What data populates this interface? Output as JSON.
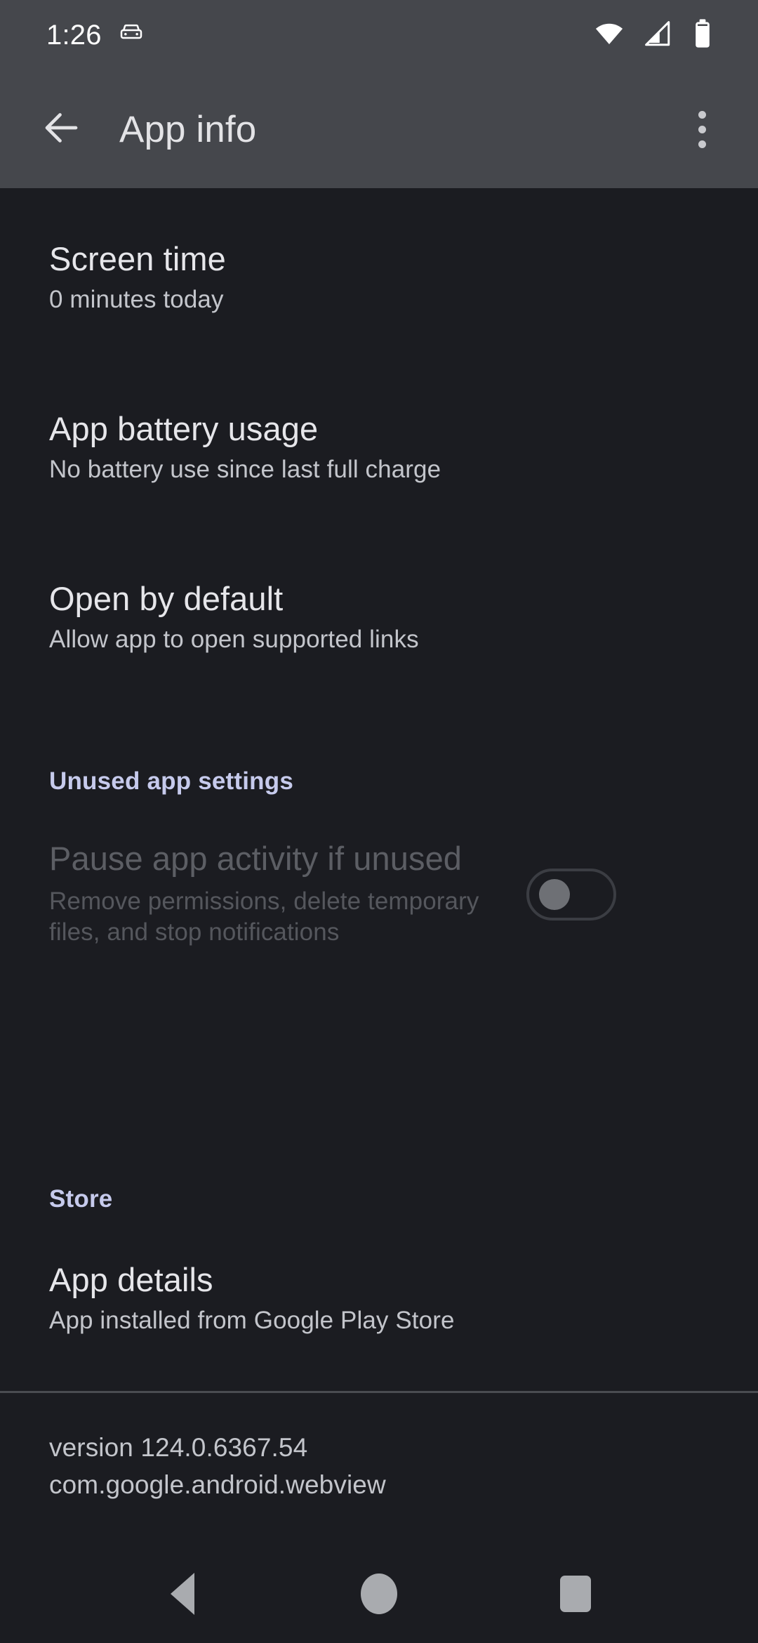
{
  "status_bar": {
    "clock": "1:26",
    "icons": {
      "car": "car-icon",
      "wifi": "wifi-icon",
      "cellular": "cellular-signal-icon",
      "battery": "battery-full-icon"
    }
  },
  "app_bar": {
    "back": "back-arrow-icon",
    "title": "App info",
    "overflow": "overflow-menu-icon"
  },
  "preferences": [
    {
      "title": "Screen time",
      "summary": "0 minutes today"
    },
    {
      "title": "App battery usage",
      "summary": "No battery use since last full charge"
    },
    {
      "title": "Open by default",
      "summary": "Allow app to open supported links"
    }
  ],
  "unused_section": {
    "header": "Unused app settings",
    "item": {
      "title": "Pause app activity if unused",
      "summary": "Remove permissions, delete temporary files, and stop notifications",
      "toggle_state": "off"
    }
  },
  "store_section": {
    "header": "Store",
    "item": {
      "title": "App details",
      "summary": "App installed from Google Play Store"
    }
  },
  "footer": {
    "version": "version 124.0.6367.54",
    "package": "com.google.android.webview"
  },
  "nav_bar": {
    "back": "nav-back-icon",
    "home": "nav-home-icon",
    "recents": "nav-recents-icon"
  },
  "colors": {
    "bar_background": "#45474c",
    "content_background": "#1b1c21",
    "accent": "#c6caec",
    "primary_text": "#e6e6ea",
    "secondary_text": "#c3c5cb",
    "disabled_text": "#5c5e64",
    "divider": "#4a4c51",
    "nav_icon": "#a9abaf"
  }
}
